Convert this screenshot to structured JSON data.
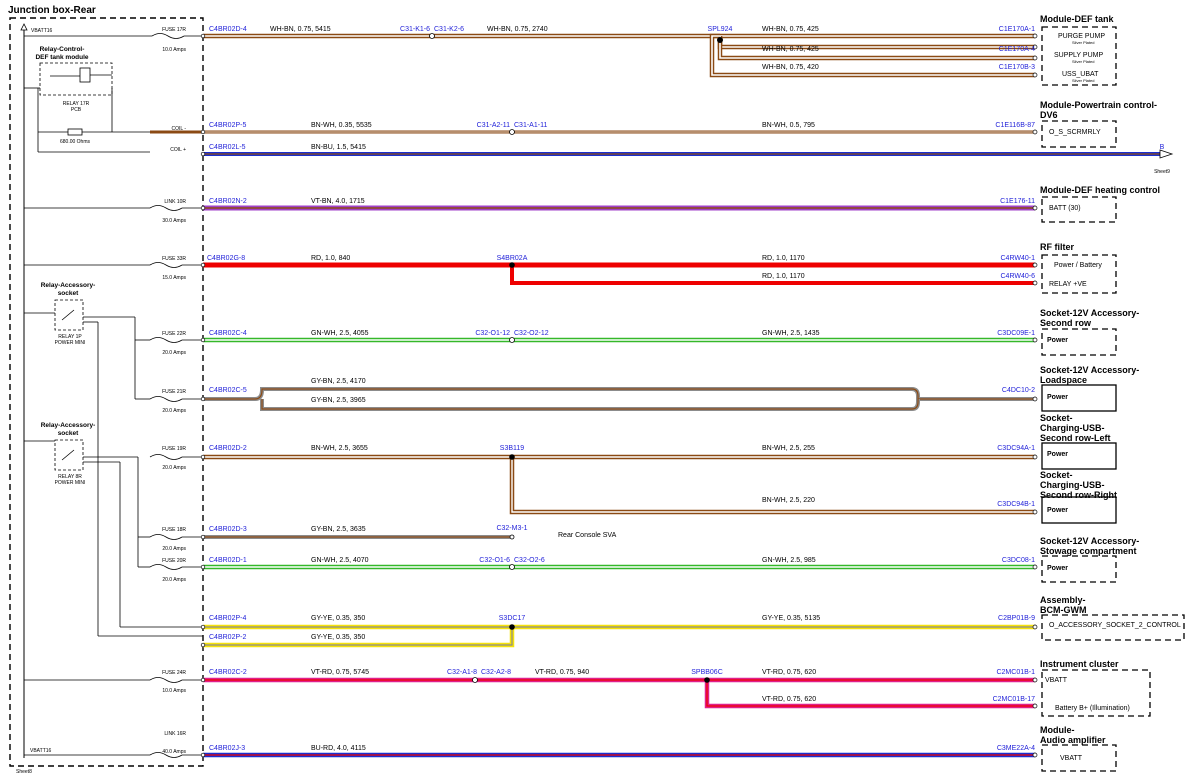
{
  "title": "Junction box-Rear",
  "vbatt_top": "VBATT16",
  "vbatt_bottom": "VBATT16",
  "bottom_corner": "Sheet8",
  "relays": [
    {
      "name": "Relay-Control-DEF tank module",
      "l1": "Relay-Control-",
      "l2": "DEF tank module",
      "rating": "RELAY 17R",
      "kind": "PCB"
    },
    {
      "name": "Relay-Accessory-socket",
      "l1": "Relay-Accessory-",
      "l2": "socket",
      "rating": "RELAY 1P",
      "kind": "POWER MINI"
    },
    {
      "name": "Relay-Accessory-socket",
      "l1": "Relay-Accessory-",
      "l2": "socket",
      "rating": "RELAY 8R",
      "kind": "POWER MINI"
    }
  ],
  "resistor": {
    "label": "680.00 Ohms",
    "coil_minus": "COIL -",
    "coil_plus": "COIL +"
  },
  "fuses": [
    {
      "id": "FUSE 17R",
      "amps": "10.0 Amps"
    },
    {
      "id": "LINK 10R",
      "amps": "30.0 Amps"
    },
    {
      "id": "FUSE 33R",
      "amps": "15.0 Amps"
    },
    {
      "id": "FUSE 22R",
      "amps": "20.0 Amps"
    },
    {
      "id": "FUSE 21R",
      "amps": "20.0 Amps"
    },
    {
      "id": "FUSE 19R",
      "amps": "20.0 Amps"
    },
    {
      "id": "FUSE 18R",
      "amps": "20.0 Amps"
    },
    {
      "id": "FUSE 20R",
      "amps": "20.0 Amps"
    },
    {
      "id": "FUSE 24R",
      "amps": "10.0 Amps"
    },
    {
      "id": "LINK 16R",
      "amps": "40.0 Amps"
    }
  ],
  "off_sheet": {
    "letter": "B",
    "sheet": "Sheet9"
  },
  "connectors": {
    "c1": "C4BR02D-4",
    "c2": "C4BR02P-5",
    "c3": "C4BR02L-5",
    "c4": "C4BR02N-2",
    "c5": "C4BR02G-8",
    "c6": "C4BR02C-4",
    "c7": "C4BR02C-5",
    "c8": "C4BR02D-2",
    "c9": "C4BR02D-3",
    "c10": "C4BR02D-1",
    "c11": "C4BR02P-4",
    "c12": "C4BR02P-2",
    "c13": "C4BR02C-2",
    "c14": "C4BR02J-3",
    "inline1": "C31-K1-6",
    "inline1b": "C31-K2-6",
    "spl1": "SPL924",
    "inline2": "C31-A2-11",
    "inline2b": "C31-A1-11",
    "spl2": "S4BR02A",
    "inline3": "C32-O1-12",
    "inline3b": "C32-O2-12",
    "spl3": "S3B119",
    "inline4": "C32-M3-1",
    "inline5": "C32-O1-6",
    "inline5b": "C32-O2-6",
    "spl4": "S3DC17",
    "inline6": "C32-A1-8",
    "inline6b": "C32-A2-8",
    "spl5": "SPBB06C",
    "e1": "C1E170A-1",
    "e2": "C1E170A-4",
    "e3": "C1E170B-3",
    "e4": "C1E116B-87",
    "e5": "C1E176-11",
    "e6": "C4RW40-1",
    "e7": "C4RW40-6",
    "e8": "C3DC09E-1",
    "e9": "C4DC10-2",
    "e10": "C3DC94A-1",
    "e11": "C3DC94B-1",
    "e12": "C3DC08-1",
    "e13": "C2BP01B-9",
    "e14": "C2MC01B-1",
    "e15": "C2MC01B-17",
    "e16": "C3ME22A-4"
  },
  "wires": {
    "w1": "WH-BN,  0.75,  5415",
    "w1b": "WH-BN,  0.75,  2740",
    "w1c": "WH-BN,  0.75,  425",
    "w1d": "WH-BN,  0.75,  425",
    "w1e": "WH-BN,  0.75,  420",
    "w2": "BN-WH,  0.35,  5535",
    "w2b": "BN-WH,  0.5,  795",
    "w3": "BN-BU,  1.5,  5415",
    "w4": "VT-BN,  4.0,  1715",
    "w5": "RD,  1.0,  840",
    "w5b": "RD,  1.0,  1170",
    "w5c": "RD,  1.0,  1170",
    "w6": "GN-WH,  2.5,  4055",
    "w6b": "GN-WH,  2.5,  1435",
    "w7": "GY-BN,  2.5,  4170",
    "w7b": "GY-BN,  2.5,  3965",
    "w8": "BN-WH,  2.5,  3655",
    "w8b": "BN-WH,  2.5,  255",
    "w8c": "BN-WH,  2.5,  220",
    "w9": "GY-BN,  2.5,  3635",
    "w10": "GN-WH,  2.5,  4070",
    "w10b": "GN-WH,  2.5,  985",
    "w11": "GY-YE,  0.35,  350",
    "w11b": "GY-YE,  0.35,  5135",
    "w12": "GY-YE,  0.35,  350",
    "w13": "VT-RD,  0.75,  5745",
    "w13b": "VT-RD,  0.75,  940",
    "w13c": "VT-RD,  0.75,  620",
    "w13d": "VT-RD,  0.75,  620",
    "w14": "BU-RD,  4.0,  4115"
  },
  "rear_console": "Rear Console SVA",
  "modules": {
    "m1": "Module-DEF tank",
    "m2a": "Module-Powertrain control-",
    "m2b": "DV6",
    "m3": "Module-DEF heating control",
    "m4": "RF filter",
    "m5a": "Socket-12V Accessory-",
    "m5b": "Second row",
    "m6a": "Socket-12V Accessory-",
    "m6b": "Loadspace",
    "m7a": "Socket-",
    "m7b": "Charging-USB-",
    "m7c": "Second row-Left",
    "m8a": "Socket-",
    "m8b": "Charging-USB-",
    "m8c": "Second row-Right",
    "m9a": "Socket-12V Accessory-",
    "m9b": "Stowage compartment",
    "m10a": "Assembly-",
    "m10b": "BCM-GWM",
    "m11": "Instrument cluster",
    "m12a": "Module-",
    "m12b": "Audio amplifier"
  },
  "pins": {
    "p1": "PURGE PUMP",
    "p1s": "Silver Plated",
    "p2": "SUPPLY PUMP",
    "p2s": "Silver Plated",
    "p3": "USS_UBAT",
    "p3s": "Silver Plated",
    "p4": "O_S_SCRMRLY",
    "p5": "BATT (30)",
    "p6": "Power / Battery",
    "p7": "RELAY +VE",
    "p8": "Power",
    "p9": "Power",
    "p10": "Power",
    "p11": "Power",
    "p12": "Power",
    "p13": "O_ACCESSORY_SOCKET_2_CONTROL",
    "p14": "VBATT",
    "p15": "Battery B+ (Illumination)",
    "p16": "VBATT"
  },
  "colors": {
    "wh": "#ffffff",
    "bn": "#8b4a14",
    "bu": "#1a2fd0",
    "vt": "#a040c8",
    "rd": "#ee0000",
    "gn": "#35b82a",
    "gy": "#8c8c8c",
    "ye": "#f5e20a",
    "connector_blue": "#1e1ed8"
  }
}
